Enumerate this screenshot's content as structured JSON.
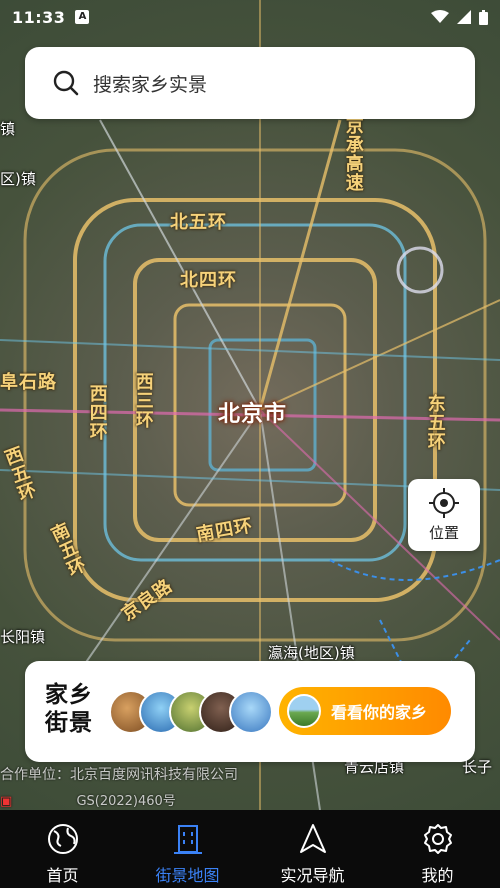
{
  "status_bar": {
    "time": "11:33",
    "a_icon": "A"
  },
  "search": {
    "placeholder": "搜索家乡实景",
    "icon": "search-icon"
  },
  "map": {
    "labels": {
      "jingcheng_gaosu": "京承高速",
      "bei_wu_huan": "北五环",
      "bei_si_huan": "北四环",
      "xi_si_huan": "西四环",
      "xi_san_huan": "西三环",
      "beijing": "北京市",
      "dong_wu_huan": "东五环",
      "xi_wu_huan": "西五环",
      "nan_wu_huan": "南五环",
      "nan_si_huan": "南四环",
      "jingliang_lu": "京良路",
      "fushi_lu": "阜石路",
      "zhen_left_top": "镇",
      "zhen_left2": "区)镇",
      "changyang_zhen": "长阳镇",
      "yinghai_zhen": "瀛海(地区)镇",
      "qingyundian_zhen": "青云店镇",
      "changzi": "长子"
    },
    "copyright": "合作单位：北京百度网讯科技有限公司",
    "gs_number": "GS(2022)460号"
  },
  "location_button": {
    "label": "位置",
    "icon": "crosshair-icon"
  },
  "hometown_card": {
    "title_line1": "家乡",
    "title_line2": "街景",
    "cta_label": "看看你的家乡"
  },
  "bottom_nav": [
    {
      "label": "首页",
      "icon": "globe-icon",
      "active": false
    },
    {
      "label": "街景地图",
      "icon": "building-icon",
      "active": true
    },
    {
      "label": "实况导航",
      "icon": "navigation-arrow-icon",
      "active": false
    },
    {
      "label": "我的",
      "icon": "gear-icon",
      "active": false
    }
  ],
  "colors": {
    "accent": "#3b82f6",
    "cta_start": "#ffb300",
    "cta_end": "#ff8a00",
    "road_label": "#f6d27a"
  }
}
